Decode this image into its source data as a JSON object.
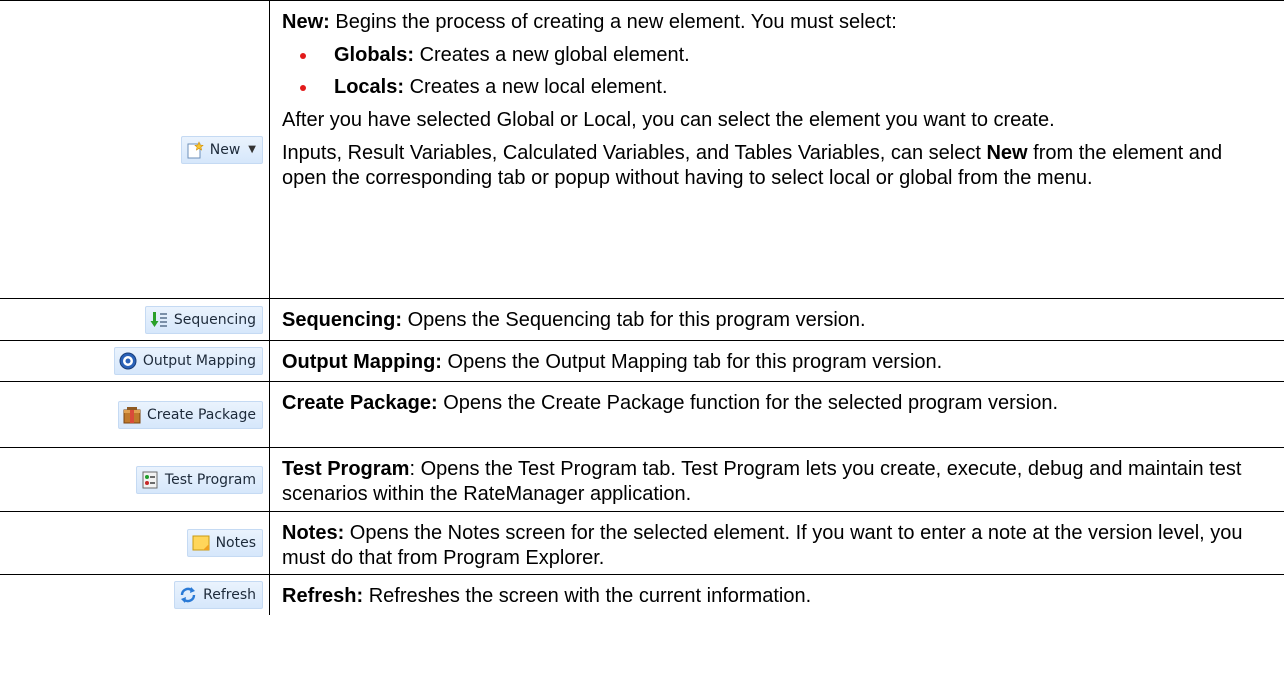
{
  "rows": [
    {
      "button": {
        "label": "New",
        "icon": "new-document-star-icon",
        "has_dropdown": true
      },
      "title": "New:",
      "intro": " Begins the process of creating a new element. You must select:",
      "bullets": [
        {
          "bold": "Globals:",
          "text": " Creates a new global element."
        },
        {
          "bold": "Locals:",
          "text": " Creates a new local element."
        }
      ],
      "para2": "After you have selected Global or Local, you can select the element you want to create.",
      "para3_pre": "Inputs, Result Variables, Calculated Variables, and Tables Variables, can select ",
      "para3_bold": "New",
      "para3_post": " from the element and open the corresponding tab or popup without having to select local or global from the menu."
    },
    {
      "button": {
        "label": "Sequencing",
        "icon": "sequencing-arrow-icon"
      },
      "title": "Sequencing:",
      "text": " Opens the Sequencing tab for this program version."
    },
    {
      "button": {
        "label": "Output Mapping",
        "icon": "output-mapping-circle-icon"
      },
      "title": "Output Mapping:",
      "text": " Opens the Output Mapping tab for this program version."
    },
    {
      "button": {
        "label": "Create Package",
        "icon": "package-box-icon"
      },
      "title": "Create Package:",
      "text": " Opens the Create Package function for the selected program version."
    },
    {
      "button": {
        "label": "Test Program",
        "icon": "test-program-icon"
      },
      "title": "Test Program",
      "text": ": Opens the Test Program tab. Test Program lets you create, execute, debug and maintain test scenarios within the RateManager application."
    },
    {
      "button": {
        "label": "Notes",
        "icon": "note-sticky-icon"
      },
      "title": "Notes:",
      "text": " Opens the Notes screen for the selected element. If you want to enter a note at the version level, you must do that from Program Explorer."
    },
    {
      "button": {
        "label": "Refresh",
        "icon": "refresh-arrows-icon"
      },
      "title": "Refresh:",
      "text": " Refreshes the screen with the current information."
    }
  ],
  "colors": {
    "border": "#000000",
    "bullet": "#e21a1a",
    "button_bg": "#d6e7fb"
  }
}
